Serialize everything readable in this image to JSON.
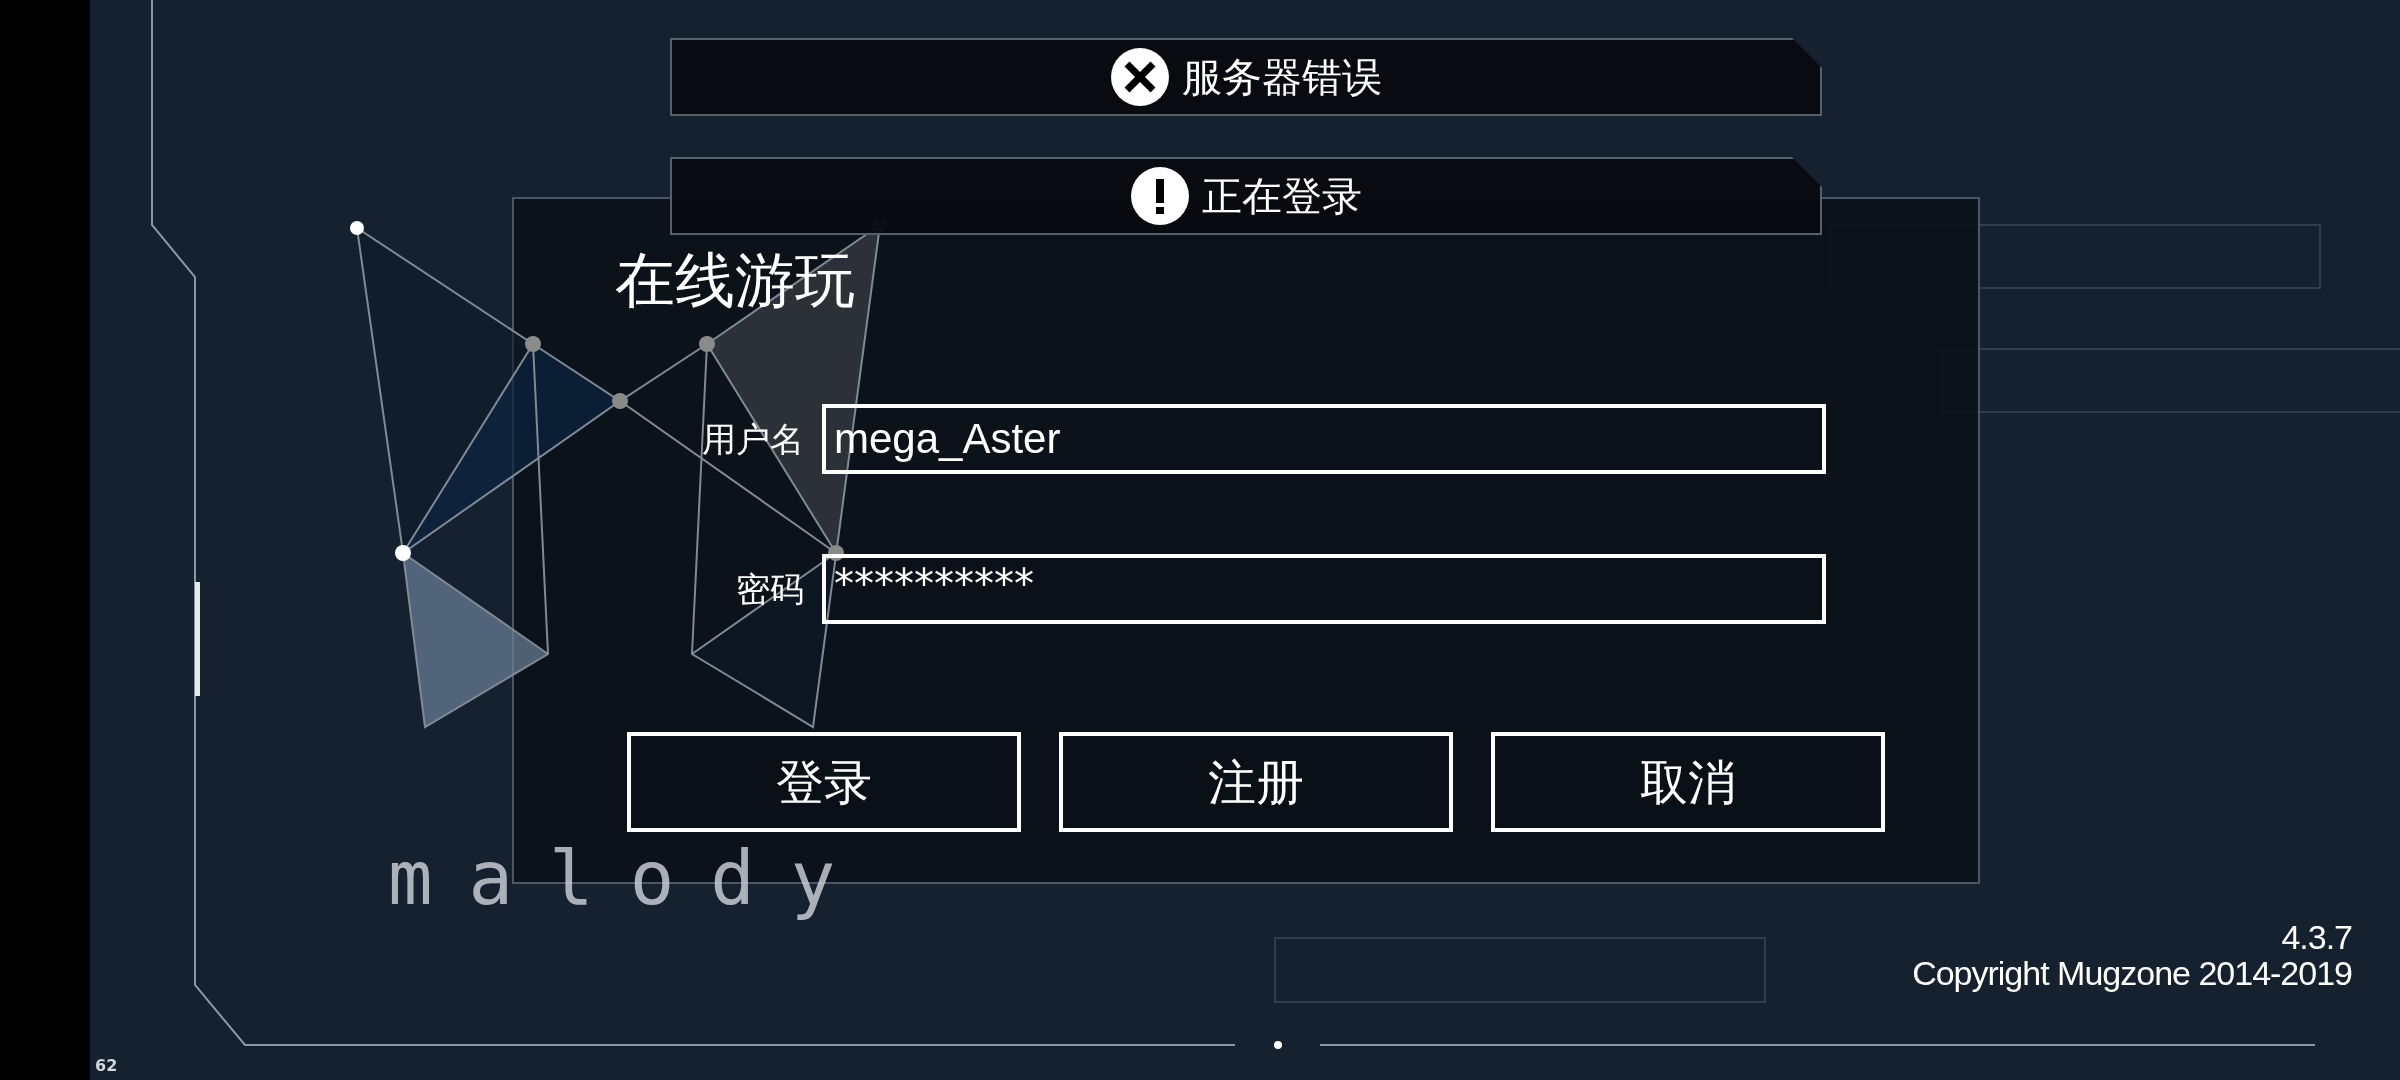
{
  "notifications": [
    {
      "kind": "error",
      "text": "服务器错误"
    },
    {
      "kind": "info",
      "text": "正在登录"
    }
  ],
  "dialog": {
    "title": "在线游玩",
    "fields": [
      {
        "kind": "text",
        "label": "用户名",
        "value": "mega_Aster"
      },
      {
        "kind": "password",
        "label": "密码",
        "value": "**********"
      }
    ],
    "buttons": [
      "登录",
      "注册",
      "取消"
    ]
  },
  "logo": "malody",
  "version": "4.3.7",
  "copyright": "Copyright Mugzone 2014-2019",
  "fps": "62"
}
